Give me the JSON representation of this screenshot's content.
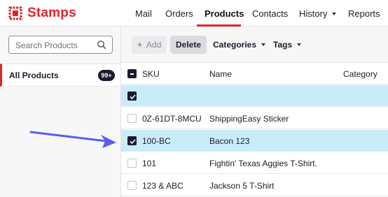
{
  "brand": {
    "name": "Stamps",
    "color": "#e0242b"
  },
  "nav": {
    "items": [
      {
        "label": "Mail"
      },
      {
        "label": "Orders"
      },
      {
        "label": "Products",
        "active": true
      },
      {
        "label": "Contacts"
      },
      {
        "label": "History",
        "has_dropdown": true
      },
      {
        "label": "Reports"
      }
    ]
  },
  "sidebar": {
    "search_placeholder": "Search Products",
    "items": [
      {
        "label": "All Products",
        "badge": "99+",
        "selected": true
      }
    ]
  },
  "toolbar": {
    "add_label": "Add",
    "delete_label": "Delete",
    "categories_label": "Categories",
    "tags_label": "Tags"
  },
  "table": {
    "columns": [
      "SKU",
      "Name",
      "Category"
    ],
    "header_checkbox": "indeterminate",
    "rows": [
      {
        "sku": "",
        "name": "",
        "category": "",
        "checked": true
      },
      {
        "sku": "0Z-61DT-8MCU",
        "name": "ShippingEasy Sticker",
        "category": "",
        "checked": false
      },
      {
        "sku": "100-BC",
        "name": "Bacon 123",
        "category": "",
        "checked": true
      },
      {
        "sku": "101",
        "name": "Fightin' Texas Aggies T-Shirt.",
        "category": "",
        "checked": false
      },
      {
        "sku": "123 & ABC",
        "name": "Jackson 5 T-Shirt",
        "category": "",
        "checked": false
      }
    ]
  },
  "colors": {
    "accent": "#e0242b",
    "selected_row": "#c9ecf9",
    "badge_bg": "#1b1b30",
    "annotation_arrow": "#5b5cf0"
  }
}
